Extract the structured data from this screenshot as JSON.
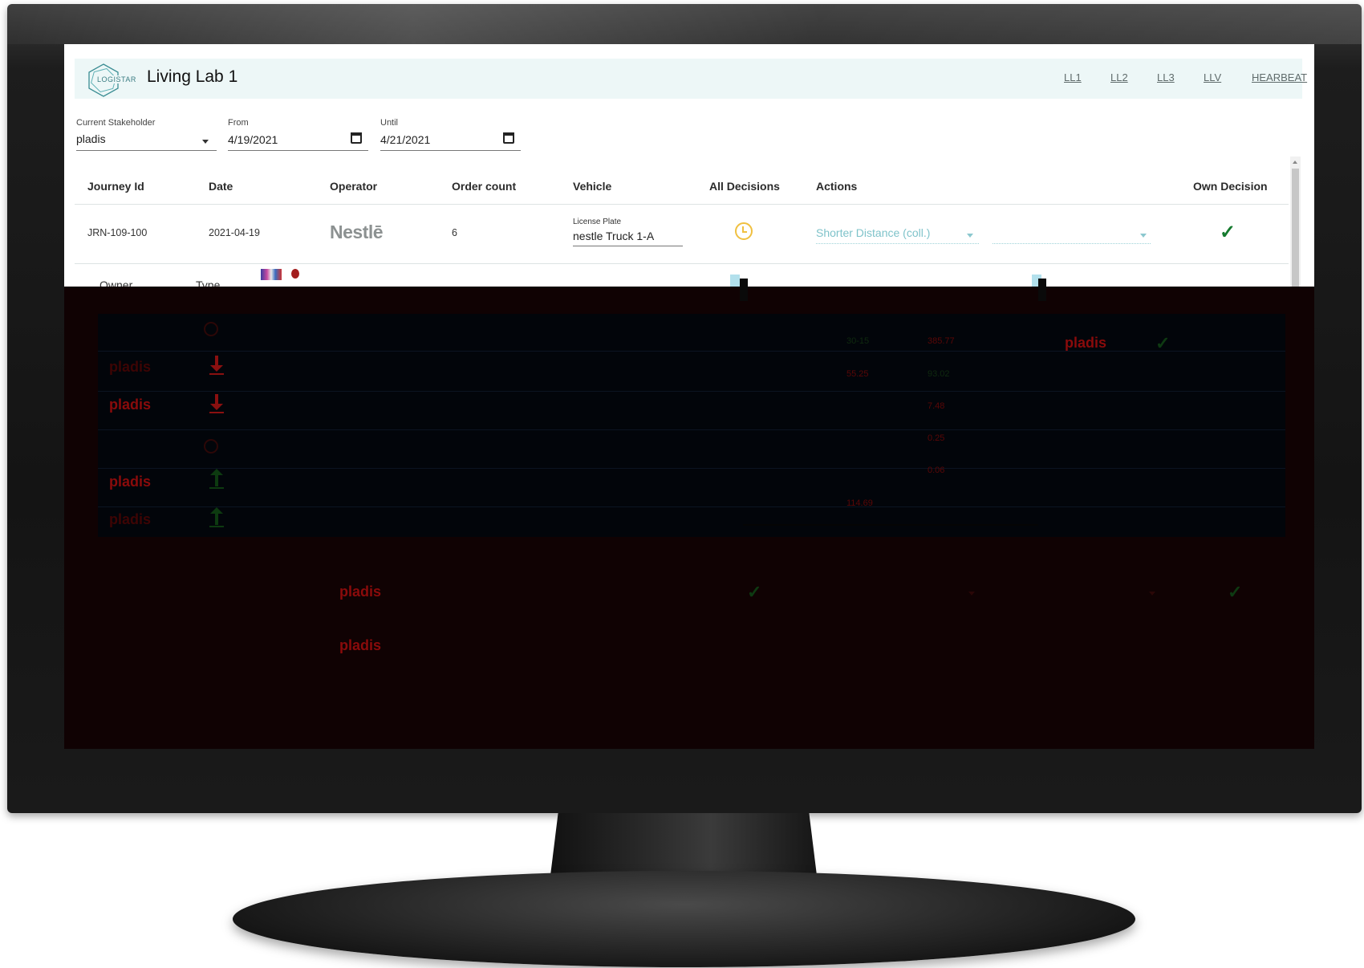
{
  "app": {
    "logo_text": "LOGISTAR",
    "title": "Living Lab 1",
    "nav": [
      "LL1",
      "LL2",
      "LL3",
      "LLV",
      "HEARBEAT"
    ]
  },
  "filters": {
    "stakeholder_label": "Current Stakeholder",
    "stakeholder_value": "pladis",
    "from_label": "From",
    "from_value": "4/19/2021",
    "until_label": "Until",
    "until_value": "4/21/2021"
  },
  "table": {
    "headers": [
      "Journey Id",
      "Date",
      "Operator",
      "Order count",
      "Vehicle",
      "All Decisions",
      "Actions",
      "Own Decision"
    ],
    "row": {
      "journey_id": "JRN-109-100",
      "date": "2021-04-19",
      "operator": "Nestlē",
      "order_count": "6",
      "vehicle_label": "License Plate",
      "vehicle_value": "nestle Truck 1-A",
      "action": "Shorter Distance (coll.)"
    }
  },
  "subtable": {
    "headers": [
      "Owner",
      "Type"
    ]
  },
  "dark_region": {
    "brand": "pladis",
    "values_red": [
      "385.77",
      "55.25",
      "7.48",
      "0.25",
      "0.06",
      "114.69"
    ],
    "values_green": [
      "30-15",
      "93.02"
    ]
  },
  "colors": {
    "accent": "#7fc3ca",
    "check": "#157a2e",
    "pending": "#f0c040",
    "appbar": "#edf7f7"
  },
  "icons": {
    "pending": "clock-icon",
    "own_decision": "check-icon"
  }
}
